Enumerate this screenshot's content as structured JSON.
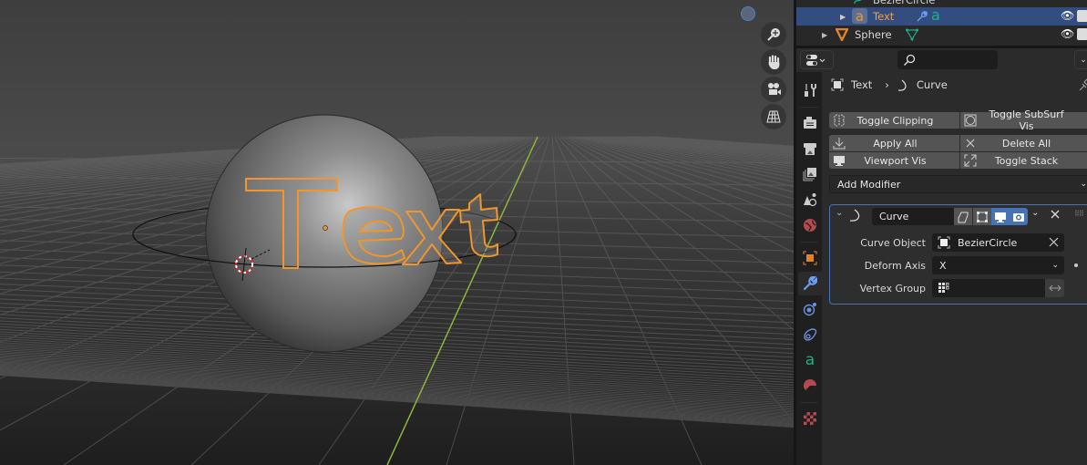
{
  "outliner": {
    "rows": [
      {
        "name": "BezierCircle",
        "type": "curve"
      },
      {
        "name": "Text",
        "type": "text",
        "selected": true,
        "modifier_icon": "wrench-icon",
        "data_icon": "text-data-icon"
      },
      {
        "name": "Sphere",
        "type": "mesh",
        "data_icon": "mesh-data-icon"
      }
    ]
  },
  "properties": {
    "search_placeholder": "",
    "breadcrumb": {
      "object": "Text",
      "separator": "›",
      "item": "Curve"
    },
    "buttons": {
      "toggle_clipping": "Toggle Clipping",
      "toggle_subsurf_vis": "Toggle SubSurf Vis",
      "apply_all": "Apply All",
      "delete_all": "Delete All",
      "viewport_vis": "Viewport Vis",
      "toggle_stack": "Toggle Stack"
    },
    "add_modifier": "Add Modifier",
    "modifier": {
      "name": "Curve",
      "fields": {
        "curve_object_label": "Curve Object",
        "curve_object_value": "BezierCircle",
        "deform_axis_label": "Deform Axis",
        "deform_axis_value": "X",
        "vertex_group_label": "Vertex Group",
        "vertex_group_value": ""
      }
    },
    "tabs": [
      "tool",
      "render",
      "output",
      "view-layer",
      "scene",
      "world",
      "object",
      "modifiers",
      "particles",
      "physics",
      "object-data",
      "material",
      "texture"
    ],
    "active_tab": "modifiers"
  },
  "viewport": {
    "text_object": "Text",
    "colors": {
      "selection": "#f0962a",
      "accent": "#4772b3",
      "y_axis": "#8ab83a"
    }
  }
}
